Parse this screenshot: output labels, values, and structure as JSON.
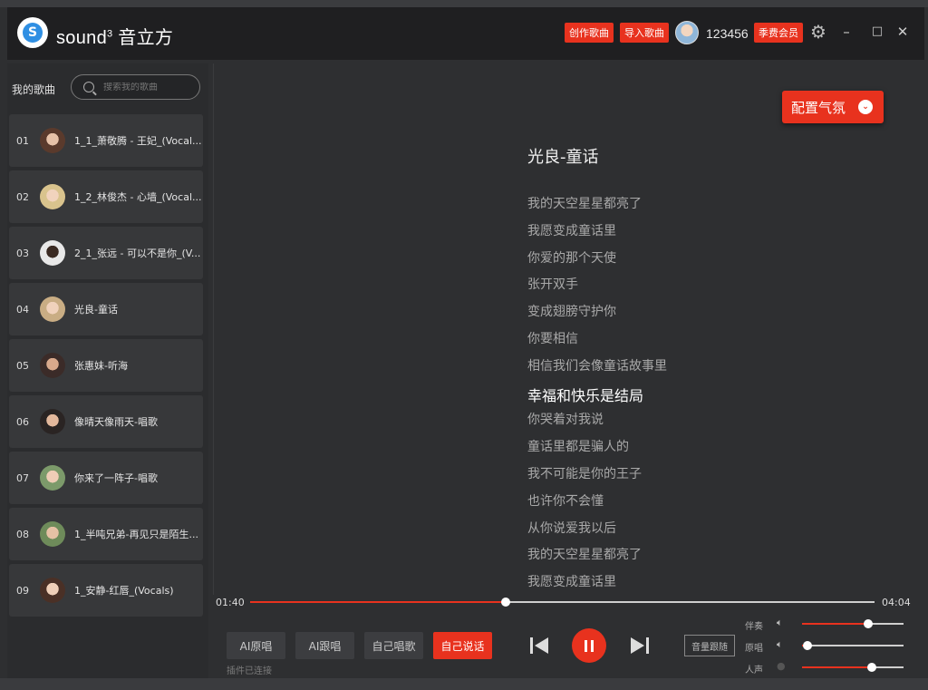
{
  "header": {
    "brand": "sound",
    "brand_sup": "3",
    "brand_cn": "音立方",
    "create_song": "创作歌曲",
    "import_song": "导入歌曲",
    "username": "123456",
    "season_member": "季费会员",
    "minimize": "–",
    "maximize": "□",
    "close": "✕"
  },
  "sidebar": {
    "label": "我的歌曲",
    "search_placeholder": "搜索我的歌曲",
    "songs": [
      {
        "num": "01",
        "title": "1_1_萧敬腾 - 王妃_(Vocal..."
      },
      {
        "num": "02",
        "title": "1_2_林俊杰 - 心墙_(Vocal..."
      },
      {
        "num": "03",
        "title": "2_1_张远 - 可以不是你_(V..."
      },
      {
        "num": "04",
        "title": "光良-童话"
      },
      {
        "num": "05",
        "title": "张惠妹-听海"
      },
      {
        "num": "06",
        "title": "像晴天像雨天-唱歌"
      },
      {
        "num": "07",
        "title": "你来了一阵子-唱歌"
      },
      {
        "num": "08",
        "title": "1_半吨兄弟-再见只是陌生..."
      },
      {
        "num": "09",
        "title": "1_安静-红唇_(Vocals)"
      }
    ]
  },
  "main": {
    "mood_button": "配置气氛",
    "song_title": "光良-童话",
    "lyrics": [
      "我的天空星星都亮了",
      "我愿变成童话里",
      "你爱的那个天使",
      "张开双手",
      "变成翅膀守护你",
      "你要相信",
      "相信我们会像童话故事里",
      "幸福和快乐是结局",
      "你哭着对我说",
      "童话里都是骗人的",
      "我不可能是你的王子",
      "也许你不会懂",
      "从你说爱我以后",
      "我的天空星星都亮了",
      "我愿变成童话里"
    ],
    "active_lyric_index": 7
  },
  "player": {
    "current_time": "01:40",
    "total_time": "04:04",
    "progress": 0.41,
    "buttons": [
      "AI原唱",
      "AI跟唱",
      "自己唱歌",
      "自己说话"
    ],
    "active_button_index": 3,
    "plugin_status": "插件已连接",
    "volume_follow": "音量跟随",
    "sliders": [
      {
        "label": "伴奏",
        "value": 0.65
      },
      {
        "label": "原唱",
        "value": 0.05
      },
      {
        "label": "人声",
        "value": 0.69
      }
    ]
  },
  "colors": {
    "accent": "#e8321e",
    "background": "#2e2f31",
    "titlebar": "#1f1f21"
  }
}
